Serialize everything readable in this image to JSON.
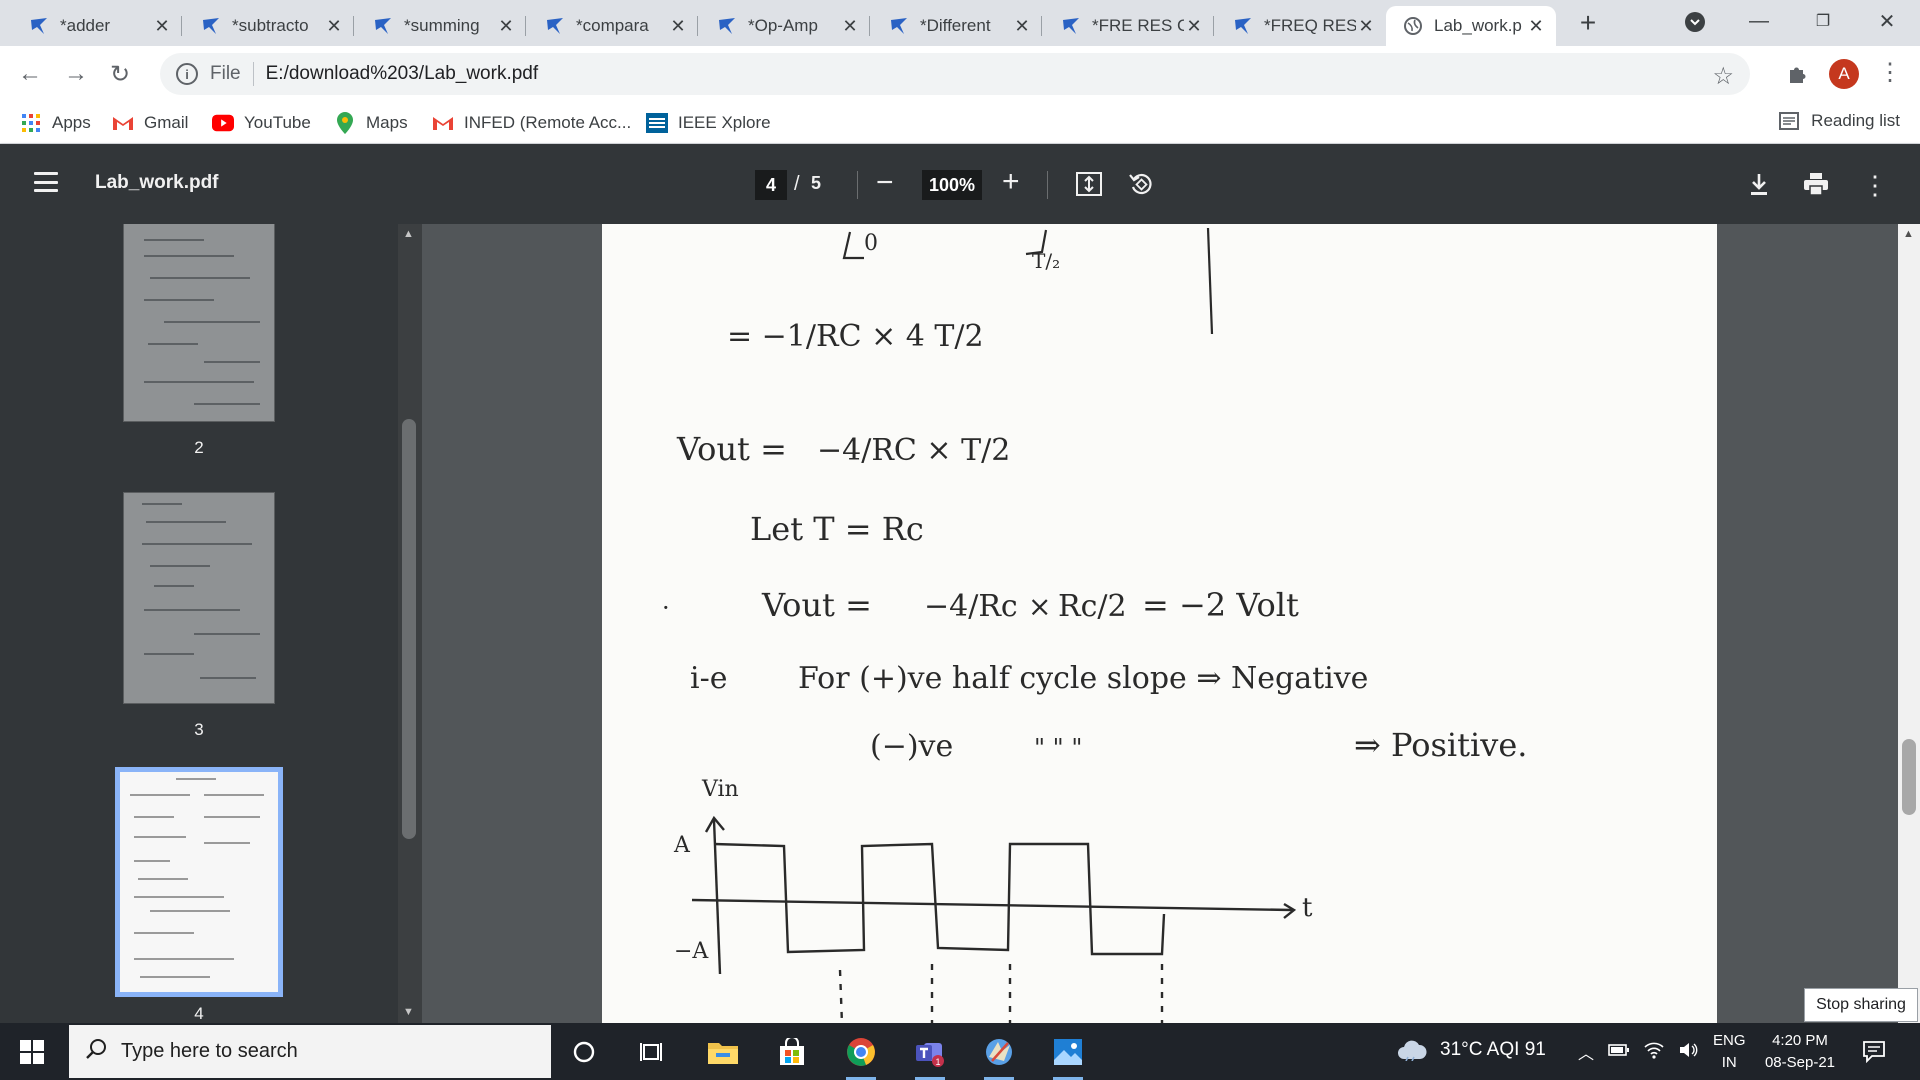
{
  "tabs": [
    {
      "title": "*adder",
      "active": false
    },
    {
      "title": "*subtracto",
      "active": false
    },
    {
      "title": "*summing",
      "active": false
    },
    {
      "title": "*compara",
      "active": false
    },
    {
      "title": "*Op-Amp",
      "active": false
    },
    {
      "title": "*Different",
      "active": false
    },
    {
      "title": "*FRE RES C",
      "active": false
    },
    {
      "title": "*FREQ RES",
      "active": false
    },
    {
      "title": "Lab_work.p",
      "active": true
    }
  ],
  "address": {
    "scheme": "File",
    "url": "E:/download%203/Lab_work.pdf"
  },
  "profile_initial": "A",
  "bookmarks": [
    {
      "label": "Apps",
      "icon": "apps-grid-icon"
    },
    {
      "label": "Gmail",
      "icon": "gmail-icon"
    },
    {
      "label": "YouTube",
      "icon": "youtube-icon"
    },
    {
      "label": "Maps",
      "icon": "maps-pin-icon"
    },
    {
      "label": "INFED (Remote Acc...",
      "icon": "gmail-icon"
    },
    {
      "label": "IEEE Xplore",
      "icon": "ieee-icon"
    }
  ],
  "reading_list": "Reading list",
  "pdf": {
    "file_title": "Lab_work.pdf",
    "current_page": "4",
    "separator": "/",
    "total_pages": "5",
    "zoom": "100%"
  },
  "thumbnails": [
    {
      "label": "2",
      "selected": false
    },
    {
      "label": "3",
      "selected": false
    },
    {
      "label": "4",
      "selected": true
    }
  ],
  "document": {
    "line1": "= −1/RC × 4 T/2",
    "line2_lhs": "Vout =",
    "line2_rhs": "−4/RC × T/2",
    "line3": "Let   T = Rc",
    "line4_lhs": "Vout =",
    "line4_frac1": "−4/Rc",
    "line4_times": "×",
    "line4_frac2": "Rc/2",
    "line4_result": "= −2 Volt",
    "line5_prefix": "i-e",
    "line5": "For (+)ve half cycle   slope ⇒ Negative",
    "line6_sign": "(−)ve",
    "line6_ditto": "\"            \"          \"",
    "line6_result": "⇒ Positive.",
    "graph_vin": "Vin",
    "graph_a": "A",
    "graph_minus_a": "−A",
    "graph_t": "t"
  },
  "stop_sharing": "Stop sharing",
  "taskbar": {
    "search_placeholder": "Type here to search",
    "weather": "31°C  AQI 91",
    "lang_line1": "ENG",
    "lang_line2": "IN",
    "time": "4:20 PM",
    "date": "08-Sep-21"
  },
  "colors": {
    "pdf_toolbar": "#323639",
    "viewer_bg": "#525659",
    "selected_thumb_border": "#8ab4f8",
    "avatar": "#c5381e",
    "taskbar": "#1f2329"
  }
}
